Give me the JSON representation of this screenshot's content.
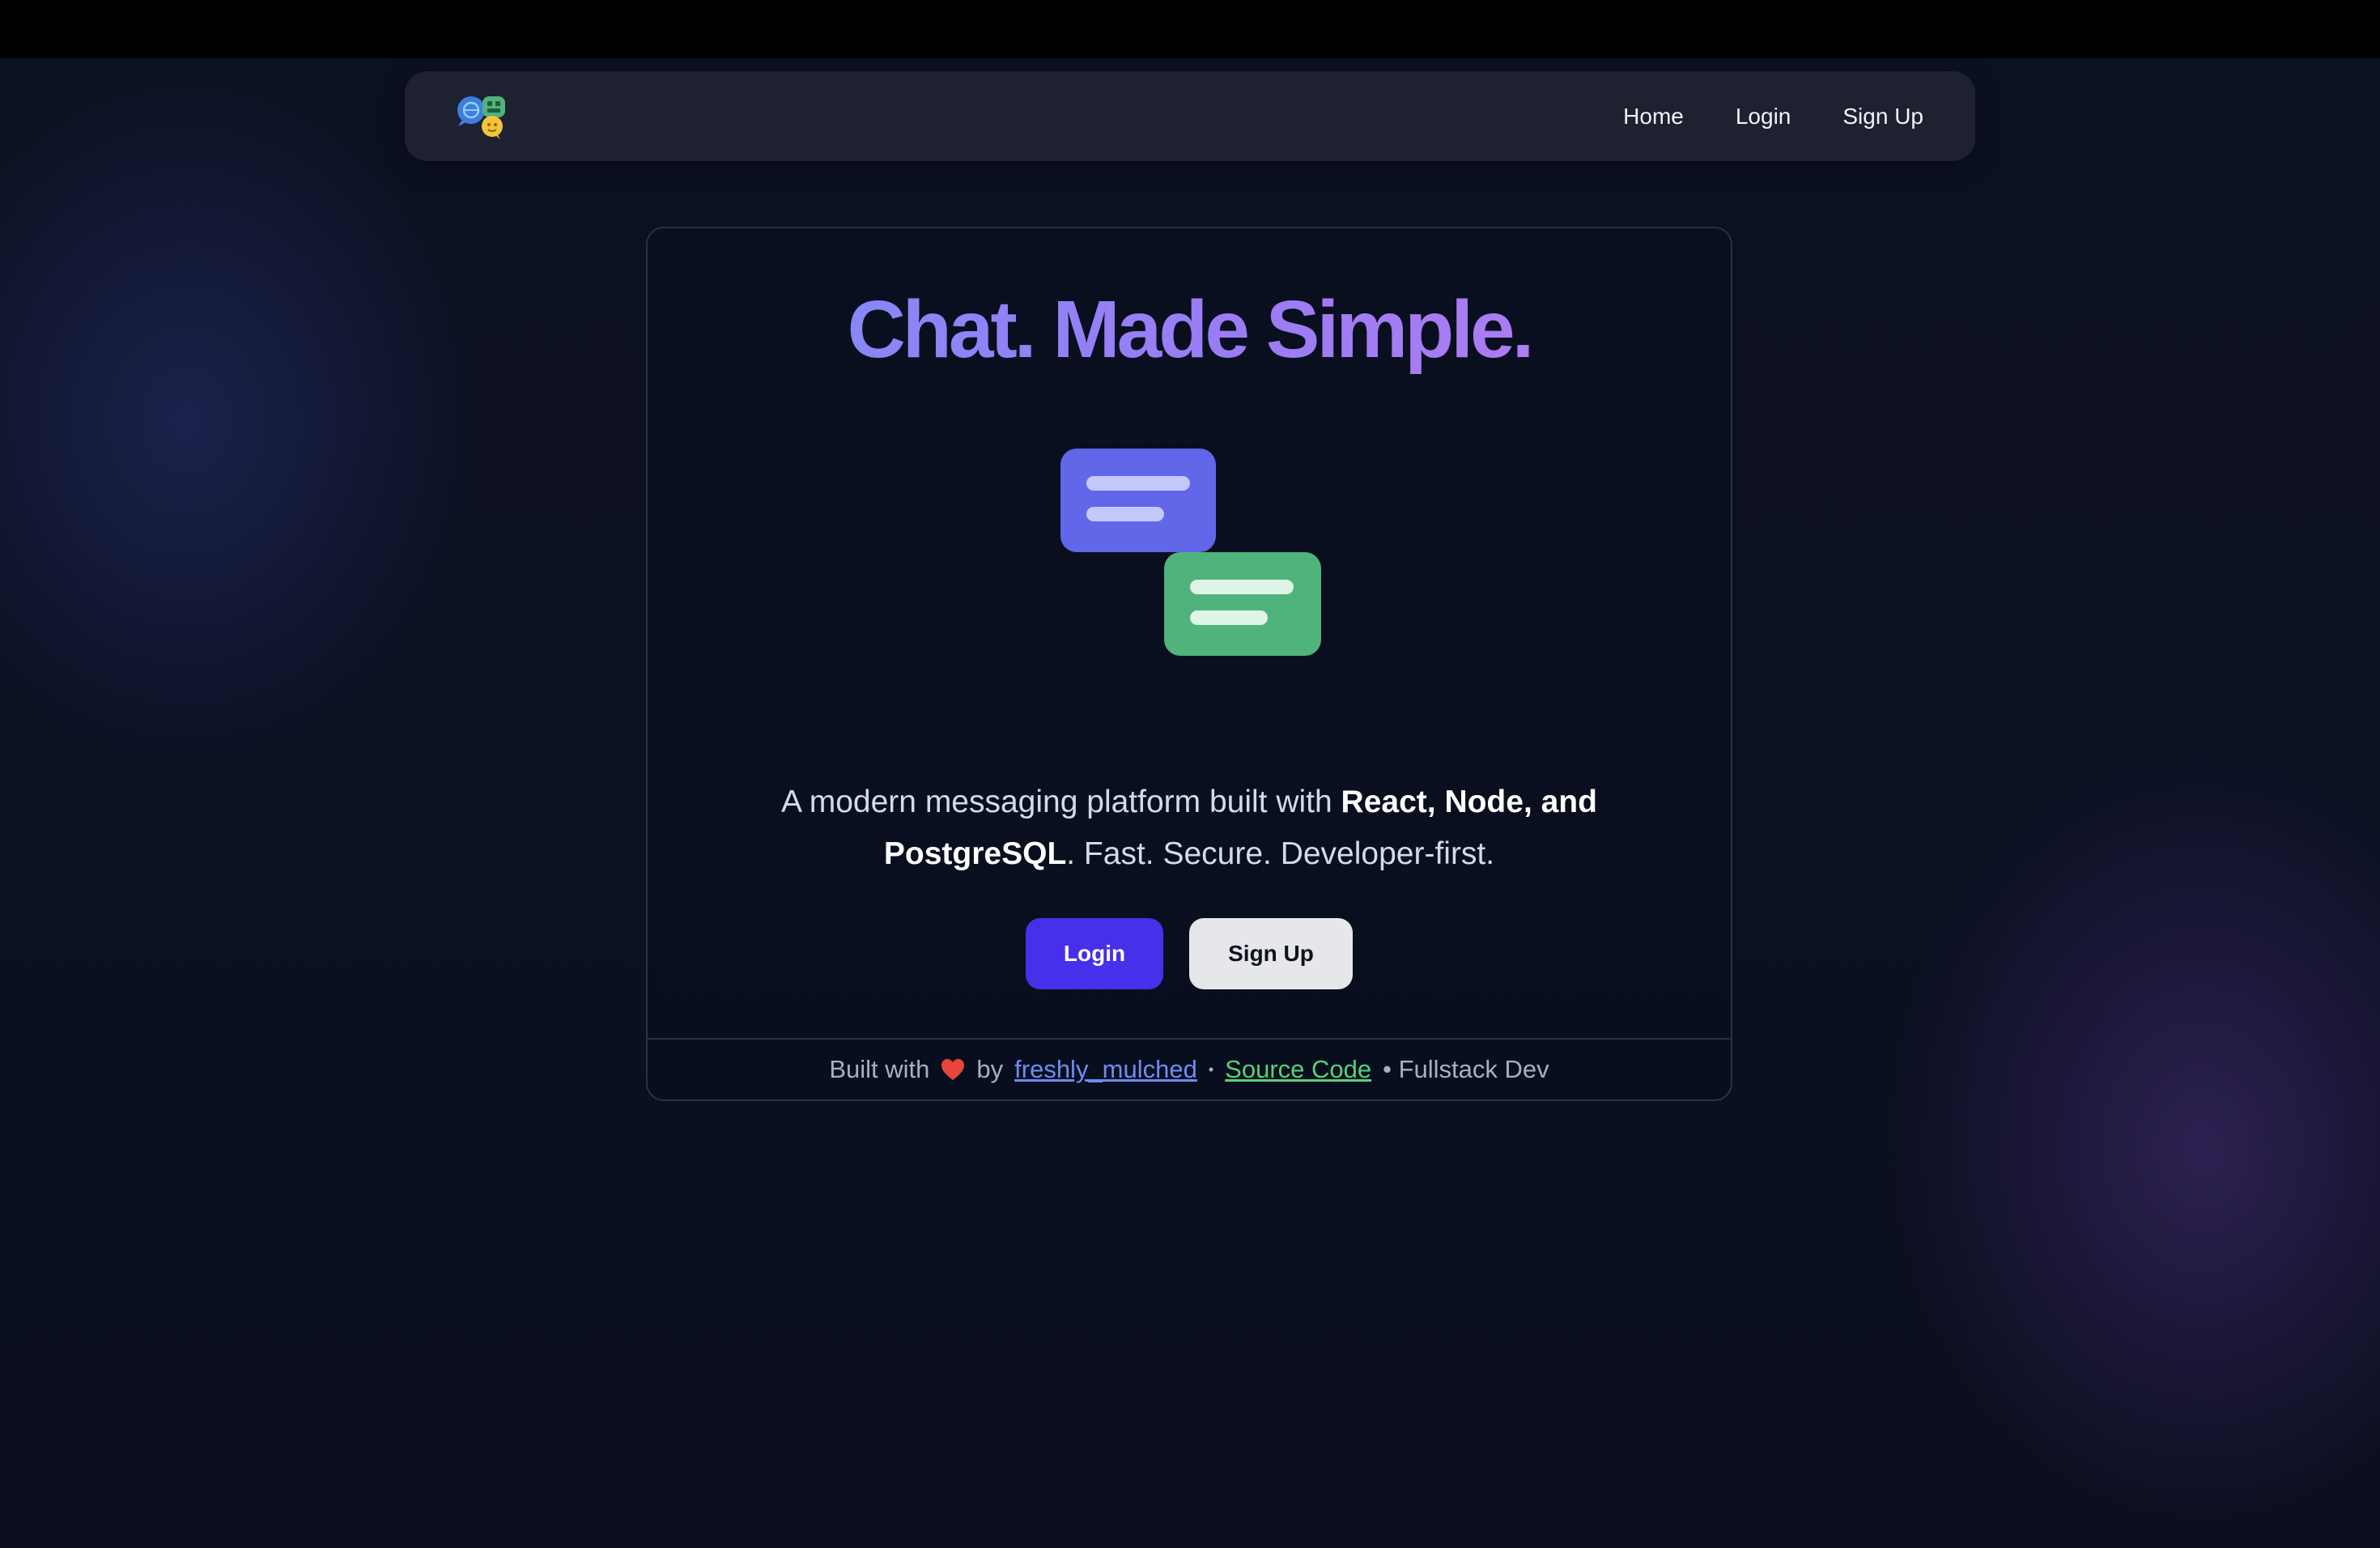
{
  "nav": {
    "logo_icon": "chat-bubbles-logo-icon",
    "links": [
      {
        "label": "Home"
      },
      {
        "label": "Login"
      },
      {
        "label": "Sign Up"
      }
    ]
  },
  "hero": {
    "headline": "Chat. Made Simple.",
    "illustration_icon": "chat-bubbles-illustration",
    "tagline_prefix": "A modern messaging platform built with ",
    "tagline_bold_1": "React, Node, and",
    "tagline_bold_2": "PostgreSQL",
    "tagline_suffix": ". Fast. Secure. Developer-first.",
    "buttons": {
      "login_label": "Login",
      "signup_label": "Sign Up"
    }
  },
  "footer": {
    "built_with": "Built with",
    "heart_icon": "heart-icon",
    "by": "by",
    "author_link": "freshly_mulched",
    "separator": "•",
    "source_link": "Source Code",
    "role": "• Fullstack Dev"
  },
  "colors": {
    "background": "#0b0f1f",
    "navbar": "#1d2130",
    "primary_button": "#4630e9",
    "secondary_button": "#e6e7eb",
    "bubble_indigo": "#6266e8",
    "bubble_green": "#4fb37b",
    "author_link": "#6c8df2",
    "source_link": "#56d07a"
  }
}
